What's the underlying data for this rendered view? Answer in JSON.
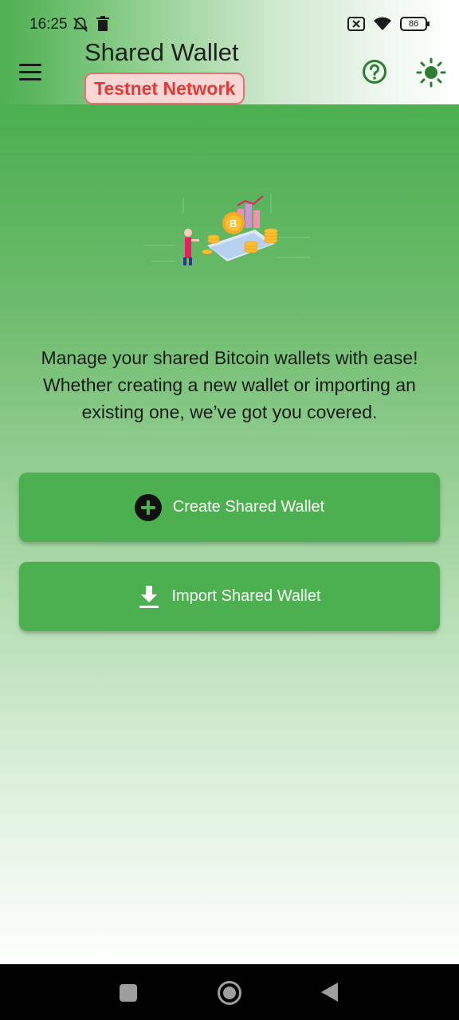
{
  "status_bar": {
    "time": "16:25",
    "battery_level": "86",
    "icons": [
      "notifications-off-icon",
      "trash-icon",
      "sim-off-icon",
      "wifi-icon",
      "battery-icon"
    ]
  },
  "app_bar": {
    "title": "Shared Wallet",
    "network_badge": "Testnet Network",
    "menu_icon": "hamburger-menu-icon",
    "help_icon": "help-circle-icon",
    "theme_icon": "sun-icon"
  },
  "hero": {
    "illustration": "bitcoin-illustration",
    "intro_text": "Manage your shared Bitcoin wallets with ease! Whether creating a new wallet or importing an existing one, we’ve got you covered."
  },
  "actions": {
    "create_label": "Create Shared Wallet",
    "create_icon": "add-circle-icon",
    "import_label": "Import Shared Wallet",
    "import_icon": "download-icon"
  },
  "nav_bar": {
    "icons": [
      "recents-square-icon",
      "home-circle-icon",
      "back-triangle-icon"
    ]
  },
  "colors": {
    "primary": "#4caf50",
    "badge_text": "#e53935",
    "badge_border": "#e57373",
    "icon_green": "#2e7d32"
  }
}
